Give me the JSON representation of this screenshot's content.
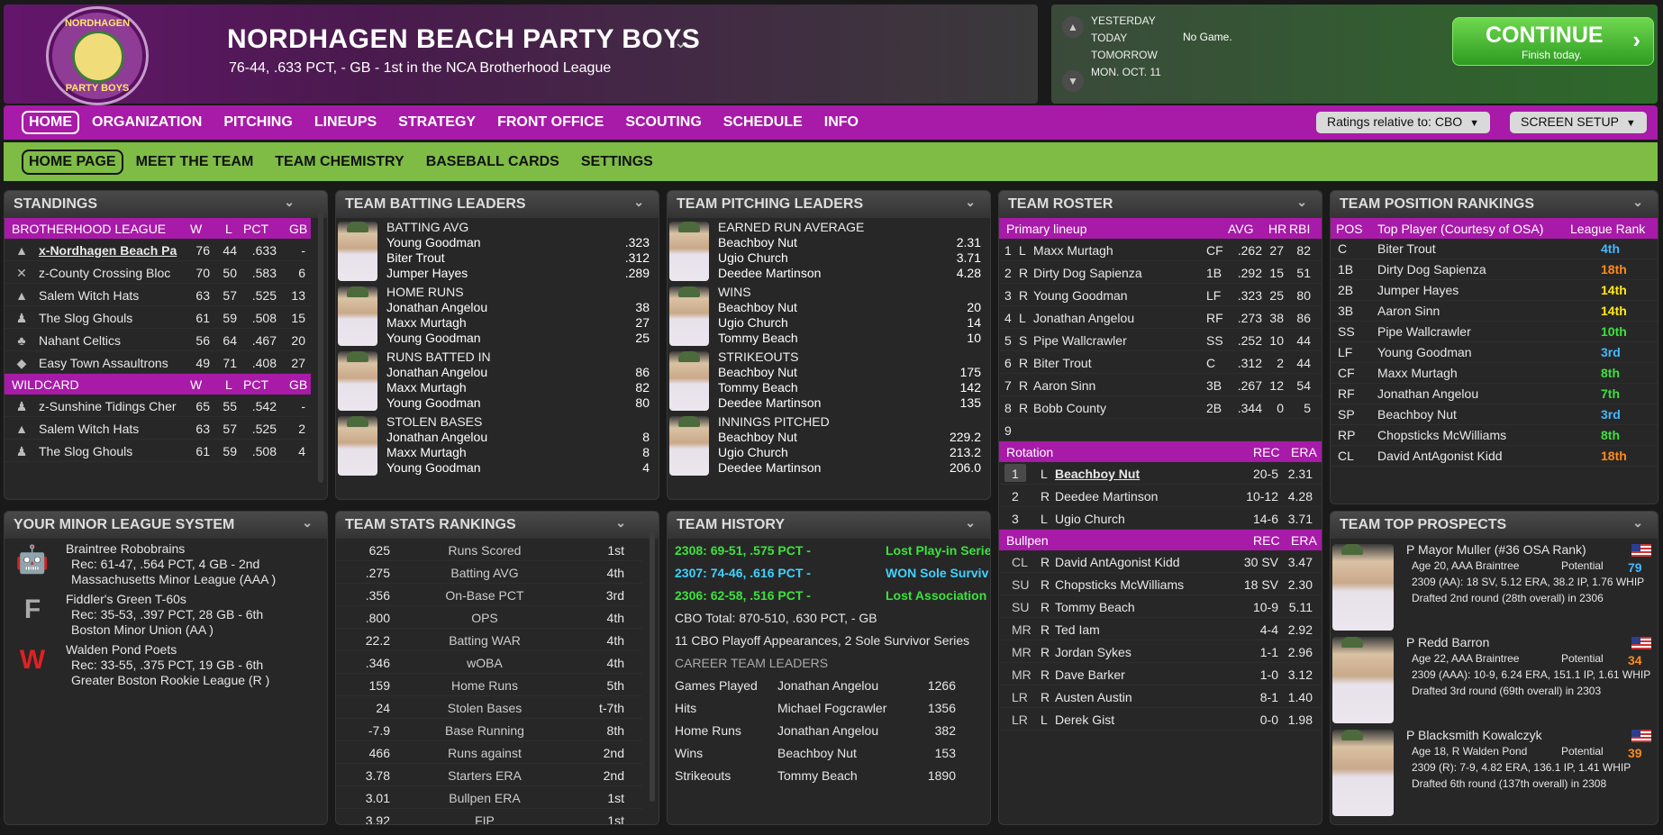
{
  "header": {
    "team_name": "NORDHAGEN BEACH PARTY BOYS",
    "record_line": "76-44, .633 PCT, - GB - 1st in the NCA Brotherhood League",
    "logo_top": "NORDHAGEN",
    "logo_bottom": "PARTY BOYS"
  },
  "schedule": {
    "days": [
      "YESTERDAY",
      "TODAY",
      "TOMORROW",
      "MON. OCT. 11"
    ],
    "today_text": "No Game.",
    "continue_label": "CONTINUE",
    "continue_sub": "Finish today."
  },
  "nav": {
    "main": [
      "HOME",
      "ORGANIZATION",
      "PITCHING",
      "LINEUPS",
      "STRATEGY",
      "FRONT OFFICE",
      "SCOUTING",
      "SCHEDULE",
      "INFO"
    ],
    "ratings_dd": "Ratings relative to: CBO",
    "screen_setup": "SCREEN SETUP",
    "sub": [
      "HOME PAGE",
      "MEET THE TEAM",
      "TEAM CHEMISTRY",
      "BASEBALL CARDS",
      "SETTINGS"
    ]
  },
  "standings": {
    "title": "STANDINGS",
    "league_header": [
      "BROTHERHOOD LEAGUE",
      "W",
      "L",
      "PCT",
      "GB"
    ],
    "league_rows": [
      {
        "team": "x-Nordhagen Beach Pa",
        "w": "76",
        "l": "44",
        "pct": ".633",
        "gb": "-",
        "icon": "▲"
      },
      {
        "team": "z-County Crossing Bloc",
        "w": "70",
        "l": "50",
        "pct": ".583",
        "gb": "6",
        "icon": "✕"
      },
      {
        "team": "Salem Witch Hats",
        "w": "63",
        "l": "57",
        "pct": ".525",
        "gb": "13",
        "icon": "▲"
      },
      {
        "team": "The Slog Ghouls",
        "w": "61",
        "l": "59",
        "pct": ".508",
        "gb": "15",
        "icon": "♟"
      },
      {
        "team": "Nahant Celtics",
        "w": "56",
        "l": "64",
        "pct": ".467",
        "gb": "20",
        "icon": "♣"
      },
      {
        "team": "Easy Town Assaultrons",
        "w": "49",
        "l": "71",
        "pct": ".408",
        "gb": "27",
        "icon": "◆"
      }
    ],
    "wildcard_header": [
      "WILDCARD",
      "W",
      "L",
      "PCT",
      "GB"
    ],
    "wildcard_rows": [
      {
        "team": "z-Sunshine Tidings Cher",
        "w": "65",
        "l": "55",
        "pct": ".542",
        "gb": "-",
        "icon": "♟"
      },
      {
        "team": "Salem Witch Hats",
        "w": "63",
        "l": "57",
        "pct": ".525",
        "gb": "2",
        "icon": "▲"
      },
      {
        "team": "The Slog Ghouls",
        "w": "61",
        "l": "59",
        "pct": ".508",
        "gb": "4",
        "icon": "♟"
      }
    ]
  },
  "batting": {
    "title": "TEAM BATTING LEADERS",
    "groups": [
      {
        "cat": "BATTING AVG",
        "rows": [
          [
            "Young Goodman",
            ".323"
          ],
          [
            "Biter Trout",
            ".312"
          ],
          [
            "Jumper Hayes",
            ".289"
          ]
        ]
      },
      {
        "cat": "HOME RUNS",
        "rows": [
          [
            "Jonathan Angelou",
            "38"
          ],
          [
            "Maxx Murtagh",
            "27"
          ],
          [
            "Young Goodman",
            "25"
          ]
        ]
      },
      {
        "cat": "RUNS BATTED IN",
        "rows": [
          [
            "Jonathan Angelou",
            "86"
          ],
          [
            "Maxx Murtagh",
            "82"
          ],
          [
            "Young Goodman",
            "80"
          ]
        ]
      },
      {
        "cat": "STOLEN BASES",
        "rows": [
          [
            "Jonathan Angelou",
            "8"
          ],
          [
            "Maxx Murtagh",
            "8"
          ],
          [
            "Young Goodman",
            "4"
          ]
        ]
      }
    ]
  },
  "pitching": {
    "title": "TEAM PITCHING LEADERS",
    "groups": [
      {
        "cat": "EARNED RUN AVERAGE",
        "rows": [
          [
            "Beachboy Nut",
            "2.31"
          ],
          [
            "Ugio Church",
            "3.71"
          ],
          [
            "Deedee Martinson",
            "4.28"
          ]
        ]
      },
      {
        "cat": "WINS",
        "rows": [
          [
            "Beachboy Nut",
            "20"
          ],
          [
            "Ugio Church",
            "14"
          ],
          [
            "Tommy Beach",
            "10"
          ]
        ]
      },
      {
        "cat": "STRIKEOUTS",
        "rows": [
          [
            "Beachboy Nut",
            "175"
          ],
          [
            "Tommy Beach",
            "142"
          ],
          [
            "Deedee Martinson",
            "135"
          ]
        ]
      },
      {
        "cat": "INNINGS PITCHED",
        "rows": [
          [
            "Beachboy Nut",
            "229.2"
          ],
          [
            "Ugio Church",
            "213.2"
          ],
          [
            "Deedee Martinson",
            "206.0"
          ]
        ]
      }
    ]
  },
  "roster": {
    "title": "TEAM ROSTER",
    "lineup_header": [
      "Primary lineup",
      "AVG",
      "HR",
      "RBI"
    ],
    "lineup": [
      [
        "1",
        "L",
        "Maxx Murtagh",
        "CF",
        ".262",
        "27",
        "82"
      ],
      [
        "2",
        "R",
        "Dirty Dog Sapienza",
        "1B",
        ".292",
        "15",
        "51"
      ],
      [
        "3",
        "R",
        "Young Goodman",
        "LF",
        ".323",
        "25",
        "80"
      ],
      [
        "4",
        "L",
        "Jonathan Angelou",
        "RF",
        ".273",
        "38",
        "86"
      ],
      [
        "5",
        "S",
        "Pipe Wallcrawler",
        "SS",
        ".252",
        "10",
        "44"
      ],
      [
        "6",
        "R",
        "Biter Trout",
        "C",
        ".312",
        "2",
        "44"
      ],
      [
        "7",
        "R",
        "Aaron Sinn",
        "3B",
        ".267",
        "12",
        "54"
      ],
      [
        "8",
        "R",
        "Bobb County",
        "2B",
        ".344",
        "0",
        "5"
      ],
      [
        "9",
        "",
        "",
        "",
        "",
        "",
        ""
      ]
    ],
    "rotation_header": [
      "Rotation",
      "REC",
      "ERA"
    ],
    "rotation": [
      [
        "1",
        "L",
        "Beachboy Nut",
        "20-5",
        "2.31"
      ],
      [
        "2",
        "R",
        "Deedee Martinson",
        "10-12",
        "4.28"
      ],
      [
        "3",
        "L",
        "Ugio Church",
        "14-6",
        "3.71"
      ]
    ],
    "bullpen_header": [
      "Bullpen",
      "REC",
      "ERA"
    ],
    "bullpen": [
      [
        "CL",
        "R",
        "David AntAgonist Kidd",
        "30 SV",
        "3.47"
      ],
      [
        "SU",
        "R",
        "Chopsticks McWilliams",
        "18 SV",
        "2.30"
      ],
      [
        "SU",
        "R",
        "Tommy Beach",
        "10-9",
        "5.11"
      ],
      [
        "MR",
        "R",
        "Ted Iam",
        "4-4",
        "2.92"
      ],
      [
        "MR",
        "R",
        "Jordan Sykes",
        "1-1",
        "2.96"
      ],
      [
        "MR",
        "R",
        "Dave Barker",
        "1-0",
        "3.12"
      ],
      [
        "LR",
        "R",
        "Austen Austin",
        "8-1",
        "1.40"
      ],
      [
        "LR",
        "L",
        "Derek Gist",
        "0-0",
        "1.98"
      ]
    ]
  },
  "position_rankings": {
    "title": "TEAM POSITION RANKINGS",
    "header": [
      "POS",
      "Top Player (Courtesy of OSA)",
      "League Rank"
    ],
    "rows": [
      [
        "C",
        "Biter Trout",
        "4th",
        "#45b8ff"
      ],
      [
        "1B",
        "Dirty Dog Sapienza",
        "18th",
        "#ff8a1d"
      ],
      [
        "2B",
        "Jumper Hayes",
        "14th",
        "#ffe81a"
      ],
      [
        "3B",
        "Aaron Sinn",
        "14th",
        "#ffe81a"
      ],
      [
        "SS",
        "Pipe Wallcrawler",
        "10th",
        "#3de23d"
      ],
      [
        "LF",
        "Young Goodman",
        "3rd",
        "#45b8ff"
      ],
      [
        "CF",
        "Maxx Murtagh",
        "8th",
        "#3de23d"
      ],
      [
        "RF",
        "Jonathan Angelou",
        "7th",
        "#3de23d"
      ],
      [
        "SP",
        "Beachboy Nut",
        "3rd",
        "#45b8ff"
      ],
      [
        "RP",
        "Chopsticks McWilliams",
        "8th",
        "#3de23d"
      ],
      [
        "CL",
        "David AntAgonist Kidd",
        "18th",
        "#ff8a1d"
      ]
    ]
  },
  "minors": {
    "title": "YOUR MINOR LEAGUE SYSTEM",
    "teams": [
      {
        "name": "Braintree Robobrains",
        "rec": "Rec: 61-47, .564 PCT, 4 GB - 2nd",
        "league": "Massachusetts Minor League (AAA )"
      },
      {
        "name": "Fiddler's Green T-60s",
        "rec": "Rec: 35-53, .397 PCT, 28 GB - 6th",
        "league": "Boston Minor Union (AA )"
      },
      {
        "name": "Walden Pond Poets",
        "rec": "Rec: 33-55, .375 PCT, 19 GB - 6th",
        "league": "Greater Boston Rookie League (R )"
      }
    ]
  },
  "stats_rankings": {
    "title": "TEAM STATS RANKINGS",
    "rows": [
      [
        "625",
        "Runs Scored",
        "1st"
      ],
      [
        ".275",
        "Batting AVG",
        "4th"
      ],
      [
        ".356",
        "On-Base PCT",
        "3rd"
      ],
      [
        ".800",
        "OPS",
        "4th"
      ],
      [
        "22.2",
        "Batting WAR",
        "4th"
      ],
      [
        ".346",
        "wOBA",
        "4th"
      ],
      [
        "159",
        "Home Runs",
        "5th"
      ],
      [
        "24",
        "Stolen Bases",
        "t-7th"
      ],
      [
        "-7.9",
        "Base Running",
        "8th"
      ],
      [
        "466",
        "Runs against",
        "2nd"
      ],
      [
        "3.78",
        "Starters ERA",
        "2nd"
      ],
      [
        "3.01",
        "Bullpen ERA",
        "1st"
      ],
      [
        "3.92",
        "FIP",
        "1st"
      ]
    ]
  },
  "history": {
    "title": "TEAM HISTORY",
    "seasons": [
      {
        "text": "2308: 69-51, .575 PCT -",
        "result": "Lost Play-in Serie",
        "color": "#3de23d"
      },
      {
        "text": "2307: 74-46, .616 PCT -",
        "result": "WON Sole Surviv",
        "color": "#3fd2ff"
      },
      {
        "text": "2306: 62-58, .516 PCT -",
        "result": "Lost Association",
        "color": "#3de23d"
      }
    ],
    "total": "CBO Total: 870-510, .630 PCT, - GB",
    "playoffs": "11 CBO Playoff Appearances, 2 Sole Survivor Series",
    "career_title": "CAREER TEAM LEADERS",
    "career": [
      [
        "Games Played",
        "Jonathan Angelou",
        "1266"
      ],
      [
        "Hits",
        "Michael Fogcrawler",
        "1356"
      ],
      [
        "Home Runs",
        "Jonathan Angelou",
        "382"
      ],
      [
        "Wins",
        "Beachboy Nut",
        "153"
      ],
      [
        "Strikeouts",
        "Tommy Beach",
        "1890"
      ]
    ]
  },
  "prospects": {
    "title": "TEAM TOP PROSPECTS",
    "potential_label": "Potential",
    "items": [
      {
        "name": "P Mayor Muller (#36 OSA Rank)",
        "age": "Age 20, AAA Braintree",
        "pot": "79",
        "pot_color": "#45b8ff",
        "line": "2309 (AA): 18 SV, 5.12 ERA, 38.2 IP, 1.76 WHIP",
        "draft": "Drafted 2nd round (28th overall) in 2306"
      },
      {
        "name": "P Redd Barron",
        "age": "Age 22, AAA Braintree",
        "pot": "34",
        "pot_color": "#ff8a1d",
        "line": "2309 (AAA): 10-9, 6.24 ERA, 151.1 IP, 1.61 WHIP",
        "draft": "Drafted 3rd round (69th overall) in 2303"
      },
      {
        "name": "P Blacksmith Kowalczyk",
        "age": "Age 18, R Walden Pond",
        "pot": "39",
        "pot_color": "#ff8a1d",
        "line": "2309 (R): 7-9, 4.82 ERA, 136.1 IP, 1.41 WHIP",
        "draft": "Drafted 6th round (137th overall) in 2308"
      }
    ]
  }
}
